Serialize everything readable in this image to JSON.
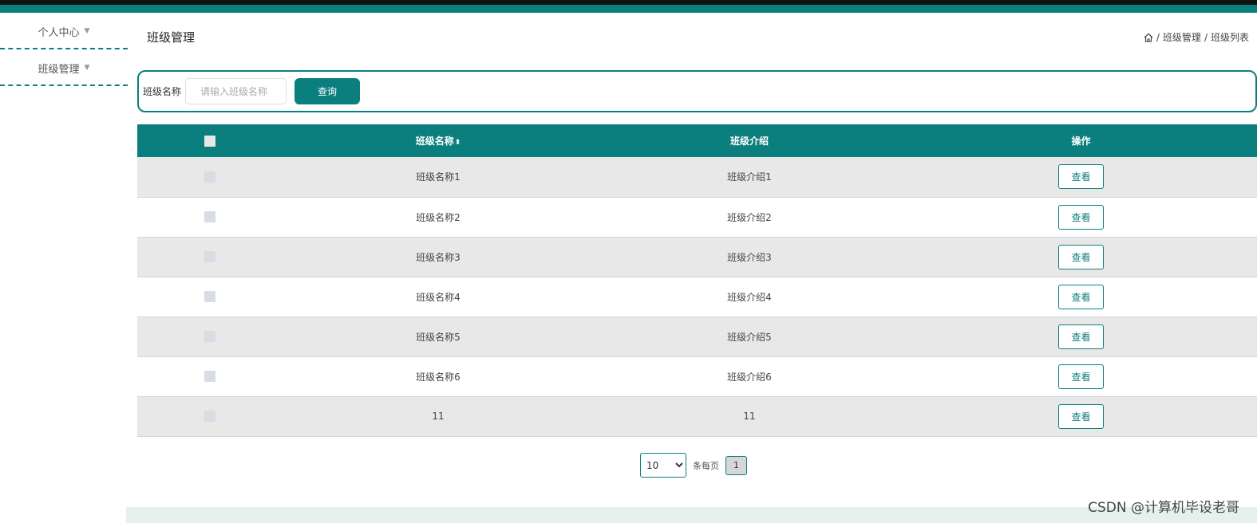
{
  "sidebar": {
    "items": [
      {
        "label": "个人中心"
      },
      {
        "label": "班级管理"
      }
    ]
  },
  "header": {
    "title": "班级管理",
    "breadcrumb": [
      "班级管理",
      "班级列表"
    ]
  },
  "search": {
    "label": "班级名称",
    "placeholder": "请输入班级名称",
    "button": "查询"
  },
  "table": {
    "columns": {
      "name": "班级名称",
      "intro": "班级介绍",
      "op": "操作"
    },
    "rows": [
      {
        "name": "班级名称1",
        "intro": "班级介绍1",
        "action": "查看"
      },
      {
        "name": "班级名称2",
        "intro": "班级介绍2",
        "action": "查看"
      },
      {
        "name": "班级名称3",
        "intro": "班级介绍3",
        "action": "查看"
      },
      {
        "name": "班级名称4",
        "intro": "班级介绍4",
        "action": "查看"
      },
      {
        "name": "班级名称5",
        "intro": "班级介绍5",
        "action": "查看"
      },
      {
        "name": "班级名称6",
        "intro": "班级介绍6",
        "action": "查看"
      },
      {
        "name": "11",
        "intro": "11",
        "action": "查看"
      }
    ]
  },
  "pagination": {
    "page_size": "10",
    "page_size_options": [
      "10"
    ],
    "per_page_label": "条每页",
    "current_page": "1"
  },
  "watermark": "CSDN @计算机毕设老哥",
  "colors": {
    "accent": "#0b7f7e",
    "row_alt": "#e8e8e8"
  }
}
